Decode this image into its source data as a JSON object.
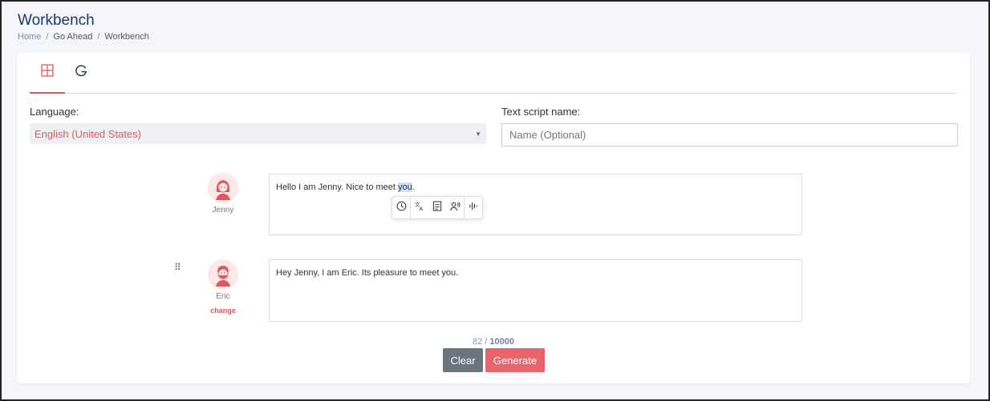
{
  "page": {
    "title": "Workbench",
    "breadcrumb": [
      "Home",
      "Go Ahead",
      "Workbench"
    ],
    "breadcrumb_sep": "/"
  },
  "tabs": [
    {
      "icon": "grid-icon",
      "active": true
    },
    {
      "icon": "google-g-icon",
      "active": false
    }
  ],
  "form": {
    "language_label": "Language:",
    "language_value": "English (United States)",
    "script_name_label": "Text script name:",
    "script_name_placeholder": "Name (Optional)"
  },
  "dialogue": [
    {
      "speaker": "Jenny",
      "text_before": "Hello I am Jenny. Nice to meet ",
      "text_selected": "you",
      "text_after": "."
    },
    {
      "speaker": "Eric",
      "change_label": "change",
      "text": "Hey Jenny, I am Eric. Its pleasure to meet you."
    }
  ],
  "toolbar_icons": [
    "clock-icon",
    "translate-icon",
    "document-icon",
    "voice-icon",
    "waveform-icon"
  ],
  "counter": {
    "used": "82",
    "sep": " / ",
    "max": "10000"
  },
  "buttons": {
    "clear": "Clear",
    "generate": "Generate"
  },
  "colors": {
    "accent": "#e05a5f",
    "clear_button": "#6c757d",
    "generate_button": "#e8646a",
    "title": "#1d3a6b"
  }
}
